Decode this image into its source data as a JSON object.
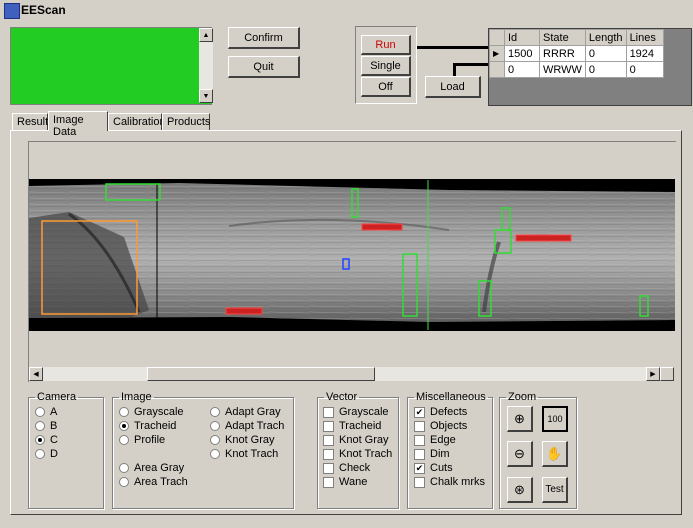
{
  "window": {
    "title": "EEScan"
  },
  "controls": {
    "confirm_label": "Confirm",
    "quit_label": "Quit",
    "run_label": "Run",
    "single_label": "Single",
    "off_label": "Off",
    "load_label": "Load"
  },
  "grid": {
    "headers": [
      "Id",
      "State",
      "Length",
      "Lines"
    ],
    "rows": [
      [
        "1500",
        "RRRR",
        "0",
        "1924"
      ],
      [
        "0",
        "WRWW",
        "0",
        "0"
      ]
    ]
  },
  "tabs": [
    "Result",
    "Image Data",
    "Calibration",
    "Products"
  ],
  "camera": {
    "title": "Camera",
    "options": [
      "A",
      "B",
      "C",
      "D"
    ],
    "selected": "C"
  },
  "image": {
    "title": "Image",
    "col1": [
      "Grayscale",
      "Tracheid",
      "Profile"
    ],
    "col1b": [
      "Area Gray",
      "Area Trach"
    ],
    "col2": [
      "Adapt Gray",
      "Adapt Trach",
      "Knot Gray",
      "Knot Trach"
    ],
    "selected": "Tracheid"
  },
  "vector": {
    "title": "Vector",
    "items": [
      "Grayscale",
      "Tracheid",
      "Knot Gray",
      "Knot Trach",
      "Check",
      "Wane"
    ]
  },
  "misc": {
    "title": "Miscellaneous",
    "items": [
      "Defects",
      "Objects",
      "Edge",
      "Dim",
      "Cuts",
      "Chalk mrks"
    ],
    "checked": [
      "Defects",
      "Cuts"
    ]
  },
  "zoom": {
    "title": "Zoom",
    "test_label": "Test",
    "icons": [
      "zoom-in-icon",
      "zoom-100-icon",
      "zoom-out-icon",
      "hand-pan-icon",
      "zoom-fit-icon"
    ]
  },
  "colors": {
    "status_green": "#22cc22",
    "run_red": "#cc0000",
    "defect_red": "#dd2222",
    "box_green": "#33dd33",
    "box_orange": "#ff9933"
  }
}
